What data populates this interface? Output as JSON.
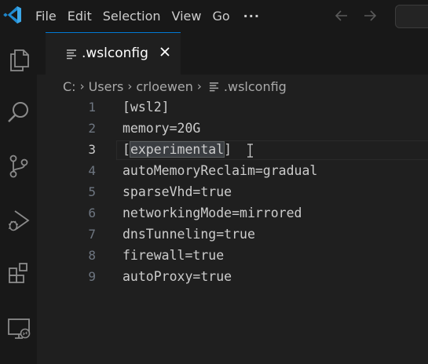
{
  "menu": {
    "items": [
      "File",
      "Edit",
      "Selection",
      "View",
      "Go"
    ],
    "more": "···"
  },
  "tab": {
    "label": ".wslconfig"
  },
  "breadcrumb": {
    "parts": [
      "C:",
      "Users",
      "crloewen"
    ],
    "file": ".wslconfig"
  },
  "editor": {
    "current_line": 3,
    "lines": [
      {
        "num": "1",
        "pre": "[wsl2]",
        "sel": "",
        "post": ""
      },
      {
        "num": "2",
        "pre": "memory=20G",
        "sel": "",
        "post": ""
      },
      {
        "num": "3",
        "pre": "[",
        "sel": "experimental",
        "post": "]"
      },
      {
        "num": "4",
        "pre": "autoMemoryReclaim=gradual",
        "sel": "",
        "post": ""
      },
      {
        "num": "5",
        "pre": "sparseVhd=true",
        "sel": "",
        "post": ""
      },
      {
        "num": "6",
        "pre": "networkingMode=mirrored",
        "sel": "",
        "post": ""
      },
      {
        "num": "7",
        "pre": "dnsTunneling=true",
        "sel": "",
        "post": ""
      },
      {
        "num": "8",
        "pre": "firewall=true",
        "sel": "",
        "post": ""
      },
      {
        "num": "9",
        "pre": "autoProxy=true",
        "sel": "",
        "post": ""
      }
    ]
  },
  "colors": {
    "accent": "#0078d4",
    "logo": "#3ca7e8",
    "text": "#cccccc",
    "line_number": "#6e7681",
    "selection": "#3a3d41"
  },
  "icons": {
    "logo": "vscode-logo-icon",
    "activity": [
      "explorer-icon",
      "search-icon",
      "source-control-icon",
      "run-debug-icon",
      "extensions-icon",
      "remote-explorer-icon"
    ],
    "tab_file": "file-lines-icon",
    "tab_close": "close-icon"
  }
}
